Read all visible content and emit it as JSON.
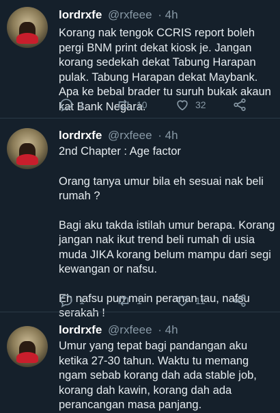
{
  "tweets": [
    {
      "name": "lordrxfe",
      "handle": "@rxfeee",
      "time": "· 4h",
      "paragraphs": [
        "Korang nak tengok CCRIS report boleh pergi BNM print dekat kiosk je. Jangan korang sedekah dekat Tabung Harapan pulak. Tabung Harapan dekat Maybank. Apa ke bebal brader tu suruh bukak akaun kat Bank Negara."
      ],
      "replies": "1",
      "retweets": "10",
      "likes": "32"
    },
    {
      "name": "lordrxfe",
      "handle": "@rxfeee",
      "time": "· 4h",
      "paragraphs": [
        "2nd Chapter : Age factor",
        "Orang tanya umur bila eh sesuai nak beli rumah ?",
        "Bagi aku takda istilah umur berapa. Korang jangan nak ikut trend beli rumah di usia muda JIKA korang belum mampu dari segi kewangan or nafsu.",
        "Eh nafsu pun main peranan tau, nafsu serakah !"
      ],
      "replies": "1",
      "retweets": "1",
      "likes": "11"
    },
    {
      "name": "lordrxfe",
      "handle": "@rxfeee",
      "time": "· 4h",
      "paragraphs": [
        "Umur yang tepat bagi pandangan aku ketika 27-30 tahun. Waktu tu memang ngam sebab korang dah ada stable job, korang dah kawin, korang dah ada perancangan masa panjang."
      ]
    }
  ],
  "icons": {
    "reply": "reply-icon",
    "retweet": "retweet-icon",
    "like": "heart-icon",
    "share": "share-icon"
  },
  "colors": {
    "background": "#15202b",
    "secondary_text": "#8899a6",
    "divider": "#2b3a47"
  }
}
